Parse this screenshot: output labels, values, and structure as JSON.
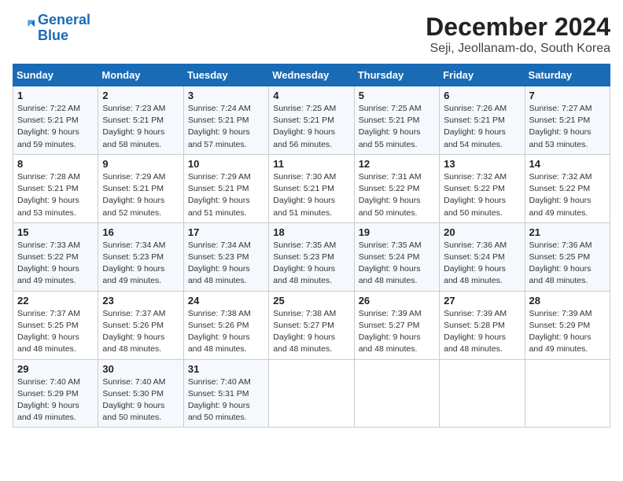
{
  "logo": {
    "line1": "General",
    "line2": "Blue"
  },
  "title": "December 2024",
  "location": "Seji, Jeollanam-do, South Korea",
  "days_of_week": [
    "Sunday",
    "Monday",
    "Tuesday",
    "Wednesday",
    "Thursday",
    "Friday",
    "Saturday"
  ],
  "weeks": [
    [
      {
        "day": "1",
        "sunrise": "Sunrise: 7:22 AM",
        "sunset": "Sunset: 5:21 PM",
        "daylight": "Daylight: 9 hours and 59 minutes."
      },
      {
        "day": "2",
        "sunrise": "Sunrise: 7:23 AM",
        "sunset": "Sunset: 5:21 PM",
        "daylight": "Daylight: 9 hours and 58 minutes."
      },
      {
        "day": "3",
        "sunrise": "Sunrise: 7:24 AM",
        "sunset": "Sunset: 5:21 PM",
        "daylight": "Daylight: 9 hours and 57 minutes."
      },
      {
        "day": "4",
        "sunrise": "Sunrise: 7:25 AM",
        "sunset": "Sunset: 5:21 PM",
        "daylight": "Daylight: 9 hours and 56 minutes."
      },
      {
        "day": "5",
        "sunrise": "Sunrise: 7:25 AM",
        "sunset": "Sunset: 5:21 PM",
        "daylight": "Daylight: 9 hours and 55 minutes."
      },
      {
        "day": "6",
        "sunrise": "Sunrise: 7:26 AM",
        "sunset": "Sunset: 5:21 PM",
        "daylight": "Daylight: 9 hours and 54 minutes."
      },
      {
        "day": "7",
        "sunrise": "Sunrise: 7:27 AM",
        "sunset": "Sunset: 5:21 PM",
        "daylight": "Daylight: 9 hours and 53 minutes."
      }
    ],
    [
      {
        "day": "8",
        "sunrise": "Sunrise: 7:28 AM",
        "sunset": "Sunset: 5:21 PM",
        "daylight": "Daylight: 9 hours and 53 minutes."
      },
      {
        "day": "9",
        "sunrise": "Sunrise: 7:29 AM",
        "sunset": "Sunset: 5:21 PM",
        "daylight": "Daylight: 9 hours and 52 minutes."
      },
      {
        "day": "10",
        "sunrise": "Sunrise: 7:29 AM",
        "sunset": "Sunset: 5:21 PM",
        "daylight": "Daylight: 9 hours and 51 minutes."
      },
      {
        "day": "11",
        "sunrise": "Sunrise: 7:30 AM",
        "sunset": "Sunset: 5:21 PM",
        "daylight": "Daylight: 9 hours and 51 minutes."
      },
      {
        "day": "12",
        "sunrise": "Sunrise: 7:31 AM",
        "sunset": "Sunset: 5:22 PM",
        "daylight": "Daylight: 9 hours and 50 minutes."
      },
      {
        "day": "13",
        "sunrise": "Sunrise: 7:32 AM",
        "sunset": "Sunset: 5:22 PM",
        "daylight": "Daylight: 9 hours and 50 minutes."
      },
      {
        "day": "14",
        "sunrise": "Sunrise: 7:32 AM",
        "sunset": "Sunset: 5:22 PM",
        "daylight": "Daylight: 9 hours and 49 minutes."
      }
    ],
    [
      {
        "day": "15",
        "sunrise": "Sunrise: 7:33 AM",
        "sunset": "Sunset: 5:22 PM",
        "daylight": "Daylight: 9 hours and 49 minutes."
      },
      {
        "day": "16",
        "sunrise": "Sunrise: 7:34 AM",
        "sunset": "Sunset: 5:23 PM",
        "daylight": "Daylight: 9 hours and 49 minutes."
      },
      {
        "day": "17",
        "sunrise": "Sunrise: 7:34 AM",
        "sunset": "Sunset: 5:23 PM",
        "daylight": "Daylight: 9 hours and 48 minutes."
      },
      {
        "day": "18",
        "sunrise": "Sunrise: 7:35 AM",
        "sunset": "Sunset: 5:23 PM",
        "daylight": "Daylight: 9 hours and 48 minutes."
      },
      {
        "day": "19",
        "sunrise": "Sunrise: 7:35 AM",
        "sunset": "Sunset: 5:24 PM",
        "daylight": "Daylight: 9 hours and 48 minutes."
      },
      {
        "day": "20",
        "sunrise": "Sunrise: 7:36 AM",
        "sunset": "Sunset: 5:24 PM",
        "daylight": "Daylight: 9 hours and 48 minutes."
      },
      {
        "day": "21",
        "sunrise": "Sunrise: 7:36 AM",
        "sunset": "Sunset: 5:25 PM",
        "daylight": "Daylight: 9 hours and 48 minutes."
      }
    ],
    [
      {
        "day": "22",
        "sunrise": "Sunrise: 7:37 AM",
        "sunset": "Sunset: 5:25 PM",
        "daylight": "Daylight: 9 hours and 48 minutes."
      },
      {
        "day": "23",
        "sunrise": "Sunrise: 7:37 AM",
        "sunset": "Sunset: 5:26 PM",
        "daylight": "Daylight: 9 hours and 48 minutes."
      },
      {
        "day": "24",
        "sunrise": "Sunrise: 7:38 AM",
        "sunset": "Sunset: 5:26 PM",
        "daylight": "Daylight: 9 hours and 48 minutes."
      },
      {
        "day": "25",
        "sunrise": "Sunrise: 7:38 AM",
        "sunset": "Sunset: 5:27 PM",
        "daylight": "Daylight: 9 hours and 48 minutes."
      },
      {
        "day": "26",
        "sunrise": "Sunrise: 7:39 AM",
        "sunset": "Sunset: 5:27 PM",
        "daylight": "Daylight: 9 hours and 48 minutes."
      },
      {
        "day": "27",
        "sunrise": "Sunrise: 7:39 AM",
        "sunset": "Sunset: 5:28 PM",
        "daylight": "Daylight: 9 hours and 48 minutes."
      },
      {
        "day": "28",
        "sunrise": "Sunrise: 7:39 AM",
        "sunset": "Sunset: 5:29 PM",
        "daylight": "Daylight: 9 hours and 49 minutes."
      }
    ],
    [
      {
        "day": "29",
        "sunrise": "Sunrise: 7:40 AM",
        "sunset": "Sunset: 5:29 PM",
        "daylight": "Daylight: 9 hours and 49 minutes."
      },
      {
        "day": "30",
        "sunrise": "Sunrise: 7:40 AM",
        "sunset": "Sunset: 5:30 PM",
        "daylight": "Daylight: 9 hours and 50 minutes."
      },
      {
        "day": "31",
        "sunrise": "Sunrise: 7:40 AM",
        "sunset": "Sunset: 5:31 PM",
        "daylight": "Daylight: 9 hours and 50 minutes."
      },
      null,
      null,
      null,
      null
    ]
  ]
}
